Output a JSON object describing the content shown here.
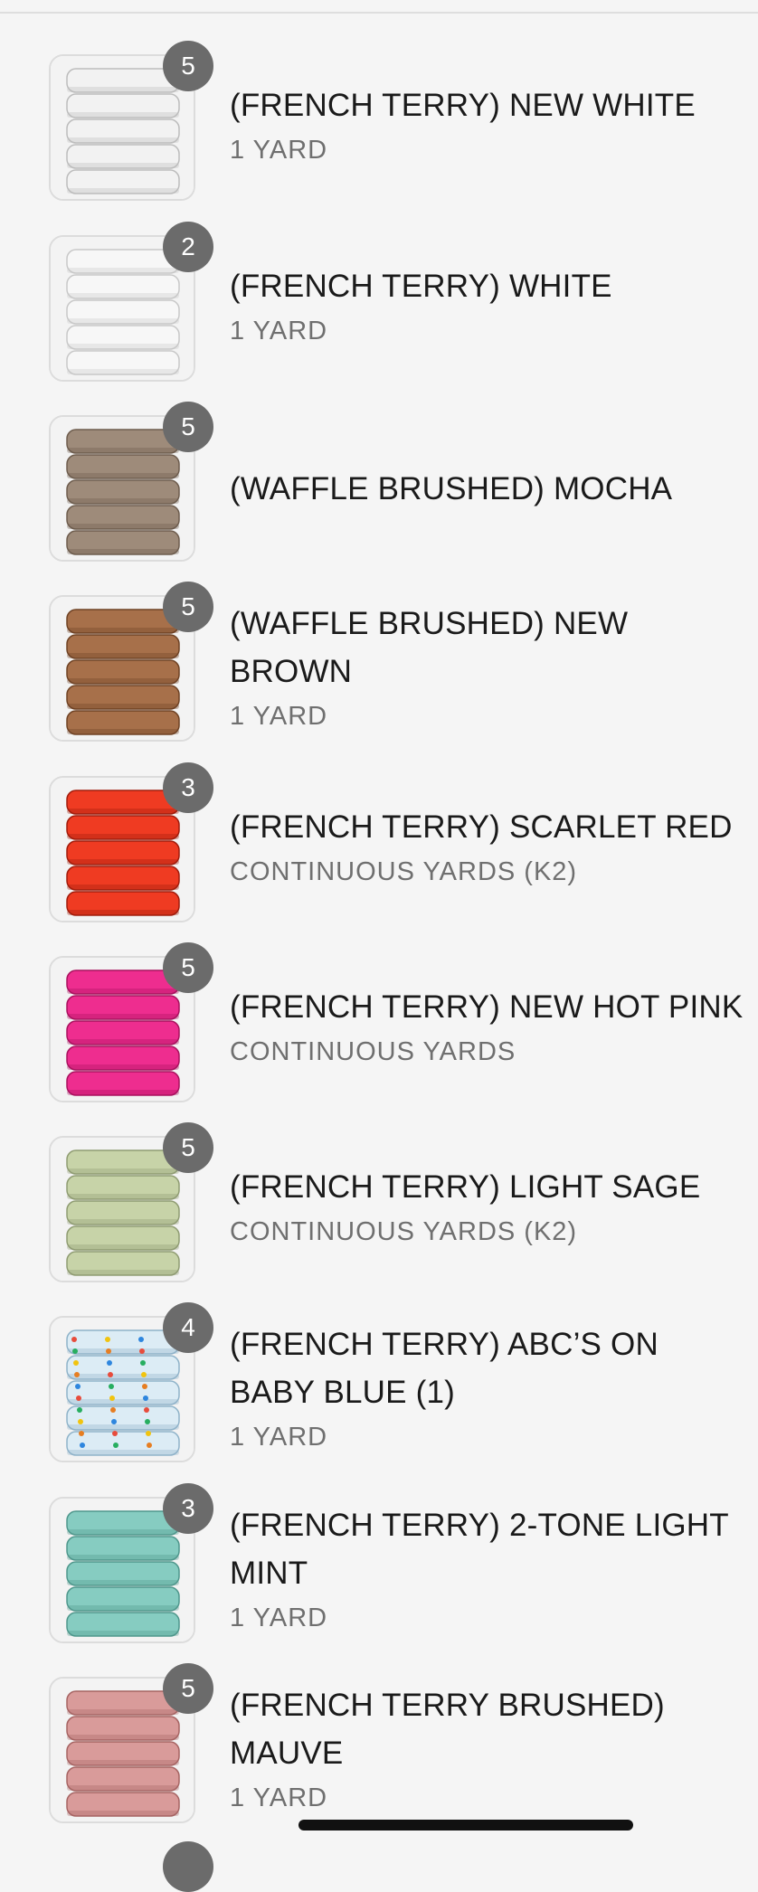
{
  "items": [
    {
      "title": "(FRENCH TERRY) NEW WHITE",
      "subtitle": "1 YARD",
      "quantity": "5",
      "swatch_color": "#f2f2f2",
      "edge_color": "#bcbcbc",
      "label": "New White"
    },
    {
      "title": "(FRENCH TERRY) WHITE",
      "subtitle": "1 YARD",
      "quantity": "2",
      "swatch_color": "#f7f7f7",
      "edge_color": "#c8c8c8",
      "label": ""
    },
    {
      "title": "(WAFFLE BRUSHED) MOCHA",
      "subtitle": "",
      "quantity": "5",
      "swatch_color": "#9e8b7a",
      "edge_color": "#6e5d4e",
      "label": "Mocha"
    },
    {
      "title": "(WAFFLE BRUSHED) NEW BROWN",
      "subtitle": "1 YARD",
      "quantity": "5",
      "swatch_color": "#a7704a",
      "edge_color": "#6f4325",
      "label": "Brown"
    },
    {
      "title": "(FRENCH TERRY) SCARLET RED",
      "subtitle": "CONTINUOUS YARDS (K2)",
      "quantity": "3",
      "swatch_color": "#ef3b22",
      "edge_color": "#a01c0c",
      "label": "Scarlet Red"
    },
    {
      "title": "(FRENCH TERRY) NEW HOT PINK",
      "subtitle": "CONTINUOUS YARDS",
      "quantity": "5",
      "swatch_color": "#ee2d8f",
      "edge_color": "#a8125e",
      "label": "New Hot Pink"
    },
    {
      "title": "(FRENCH TERRY) LIGHT SAGE",
      "subtitle": "CONTINUOUS YARDS (K2)",
      "quantity": "5",
      "swatch_color": "#c7d3a8",
      "edge_color": "#8f9c72",
      "label": "Light Sage"
    },
    {
      "title": "(FRENCH TERRY) ABC’S ON BABY BLUE (1)",
      "subtitle": "1 YARD",
      "quantity": "4",
      "swatch_color": "#dcecf5",
      "edge_color": "#8fb3c9",
      "label": ""
    },
    {
      "title": "(FRENCH TERRY) 2-TONE LIGHT MINT",
      "subtitle": "1 YARD",
      "quantity": "3",
      "swatch_color": "#86ccc1",
      "edge_color": "#4f978c",
      "label": "Light Mint"
    },
    {
      "title": "(FRENCH TERRY BRUSHED) MAUVE",
      "subtitle": "1 YARD",
      "quantity": "5",
      "swatch_color": "#d99b9a",
      "edge_color": "#a66463",
      "label": "Mauve"
    }
  ]
}
